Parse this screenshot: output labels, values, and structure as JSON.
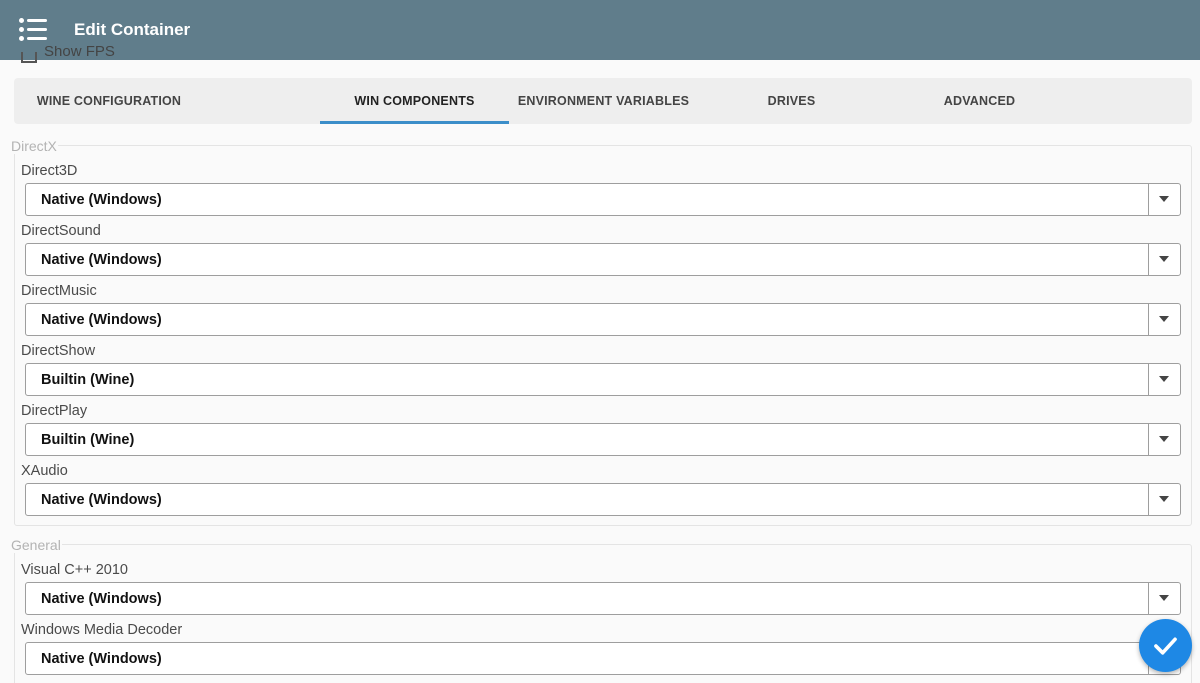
{
  "appbar": {
    "title": "Edit Container",
    "menu_icon": "hamburger-list-icon"
  },
  "show_fps": {
    "label": "Show FPS",
    "checked": false
  },
  "tabs": [
    {
      "label": "WINE CONFIGURATION",
      "active": false
    },
    {
      "label": "WIN COMPONENTS",
      "active": true
    },
    {
      "label": "ENVIRONMENT VARIABLES",
      "active": false
    },
    {
      "label": "DRIVES",
      "active": false
    },
    {
      "label": "ADVANCED",
      "active": false
    }
  ],
  "directx": {
    "title": "DirectX",
    "fields": [
      {
        "label": "Direct3D",
        "value": "Native (Windows)"
      },
      {
        "label": "DirectSound",
        "value": "Native (Windows)"
      },
      {
        "label": "DirectMusic",
        "value": "Native (Windows)"
      },
      {
        "label": "DirectShow",
        "value": "Builtin (Wine)"
      },
      {
        "label": "DirectPlay",
        "value": "Builtin (Wine)"
      },
      {
        "label": "XAudio",
        "value": "Native (Windows)"
      }
    ]
  },
  "general": {
    "title": "General",
    "fields": [
      {
        "label": "Visual C++ 2010",
        "value": "Native (Windows)"
      },
      {
        "label": "Windows Media Decoder",
        "value": "Native (Windows)"
      }
    ]
  },
  "fab": {
    "icon": "checkmark-icon"
  },
  "colors": {
    "appbar": "#607d8b",
    "tab_indicator": "#3b8ec9",
    "fab": "#1e88e5"
  }
}
